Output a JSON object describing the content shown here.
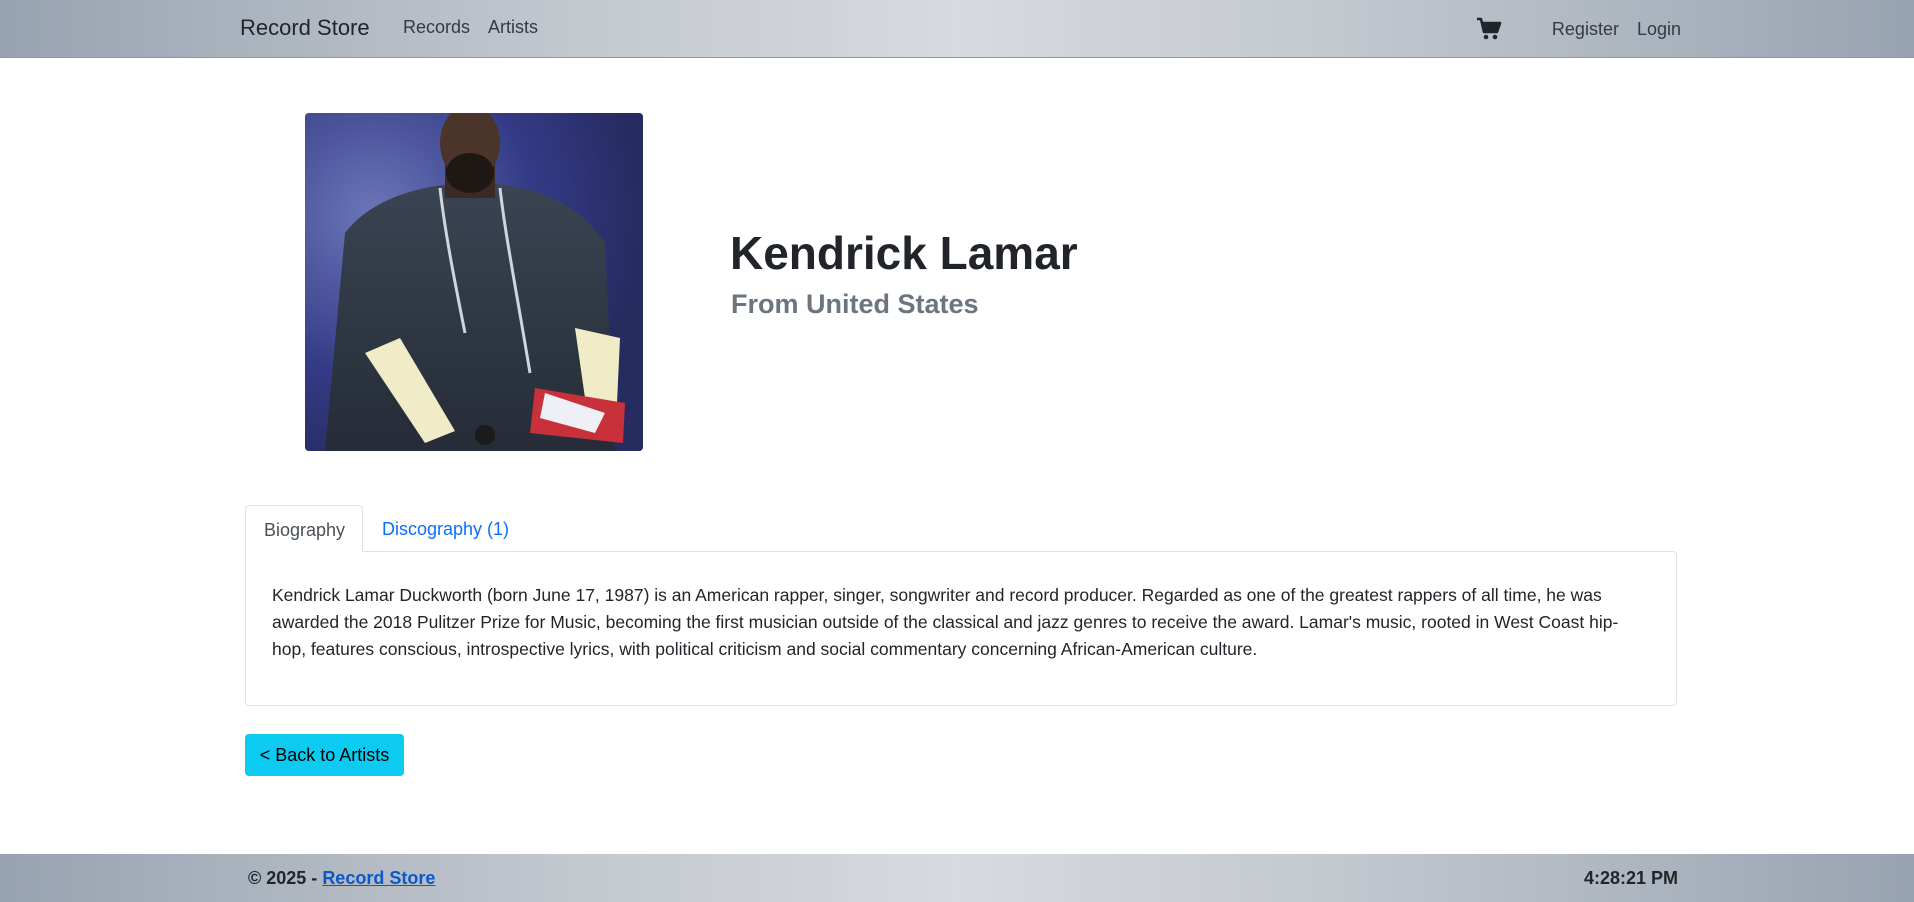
{
  "navbar": {
    "brand": "Record Store",
    "links": [
      "Records",
      "Artists"
    ],
    "cart_icon": "cart-icon",
    "register": "Register",
    "login": "Login"
  },
  "artist": {
    "name": "Kendrick Lamar",
    "from": "From  United States",
    "photo": "artist-photo"
  },
  "tabs": [
    {
      "label": "Biography",
      "active": true
    },
    {
      "label": "Discography (1)",
      "active": false
    }
  ],
  "biography": "Kendrick Lamar Duckworth (born June 17, 1987) is an American rapper, singer, songwriter and record producer. Regarded as one of the greatest rappers of all time, he was awarded the 2018 Pulitzer Prize for Music, becoming the first musician outside of the classical and jazz genres to receive the award. Lamar's music, rooted in West Coast hip-hop, features conscious, introspective lyrics, with political criticism and social commentary concerning African-American culture.",
  "back_button": "< Back to Artists",
  "footer": {
    "copyright": "© 2025 - ",
    "link": "Record Store",
    "time": "4:28:21 PM"
  },
  "colors": {
    "link": "#0d6efd",
    "button": "#0dcaf0",
    "muted": "#6c757d"
  }
}
